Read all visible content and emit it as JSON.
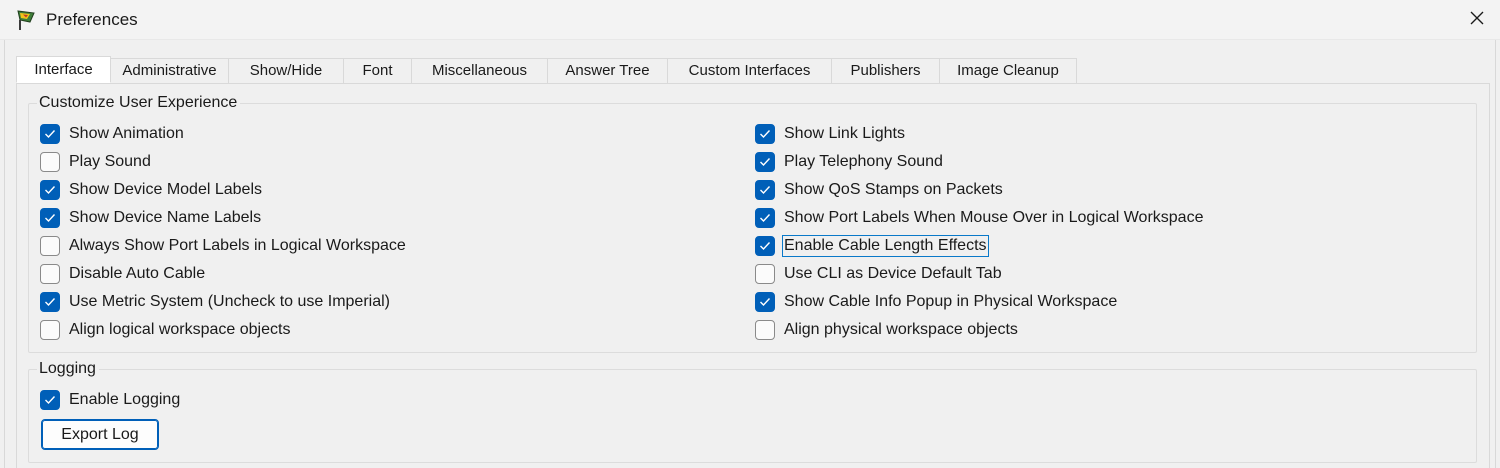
{
  "window": {
    "title": "Preferences",
    "app_icon": "packet-tracer-icon",
    "close_icon": "close-icon"
  },
  "tabs": [
    {
      "label": "Interface",
      "active": true
    },
    {
      "label": "Administrative",
      "active": false
    },
    {
      "label": "Show/Hide",
      "active": false
    },
    {
      "label": "Font",
      "active": false
    },
    {
      "label": "Miscellaneous",
      "active": false
    },
    {
      "label": "Answer Tree",
      "active": false
    },
    {
      "label": "Custom Interfaces",
      "active": false
    },
    {
      "label": "Publishers",
      "active": false
    },
    {
      "label": "Image Cleanup",
      "active": false
    }
  ],
  "customize": {
    "legend": "Customize User Experience",
    "left": [
      {
        "label": "Show Animation",
        "checked": true
      },
      {
        "label": "Play Sound",
        "checked": false
      },
      {
        "label": "Show Device Model Labels",
        "checked": true
      },
      {
        "label": "Show Device Name Labels",
        "checked": true
      },
      {
        "label": "Always Show Port Labels in Logical Workspace",
        "checked": false
      },
      {
        "label": "Disable Auto Cable",
        "checked": false
      },
      {
        "label": "Use Metric System (Uncheck to use Imperial)",
        "checked": true
      },
      {
        "label": "Align logical workspace objects",
        "checked": false
      }
    ],
    "right": [
      {
        "label": "Show Link Lights",
        "checked": true
      },
      {
        "label": "Play Telephony Sound",
        "checked": true
      },
      {
        "label": "Show QoS Stamps on Packets",
        "checked": true
      },
      {
        "label": "Show Port Labels When Mouse Over in Logical Workspace",
        "checked": true
      },
      {
        "label": "Enable Cable Length Effects",
        "checked": true,
        "focused": true
      },
      {
        "label": "Use CLI as Device Default Tab",
        "checked": false
      },
      {
        "label": "Show Cable Info Popup in Physical Workspace",
        "checked": true
      },
      {
        "label": "Align physical workspace objects",
        "checked": false
      }
    ]
  },
  "logging": {
    "legend": "Logging",
    "enable_label": "Enable Logging",
    "enable_checked": true,
    "export_button": "Export Log"
  },
  "colors": {
    "accent": "#005fb8",
    "background": "#f0f0f0",
    "focus_outline": "#0a79c9"
  }
}
